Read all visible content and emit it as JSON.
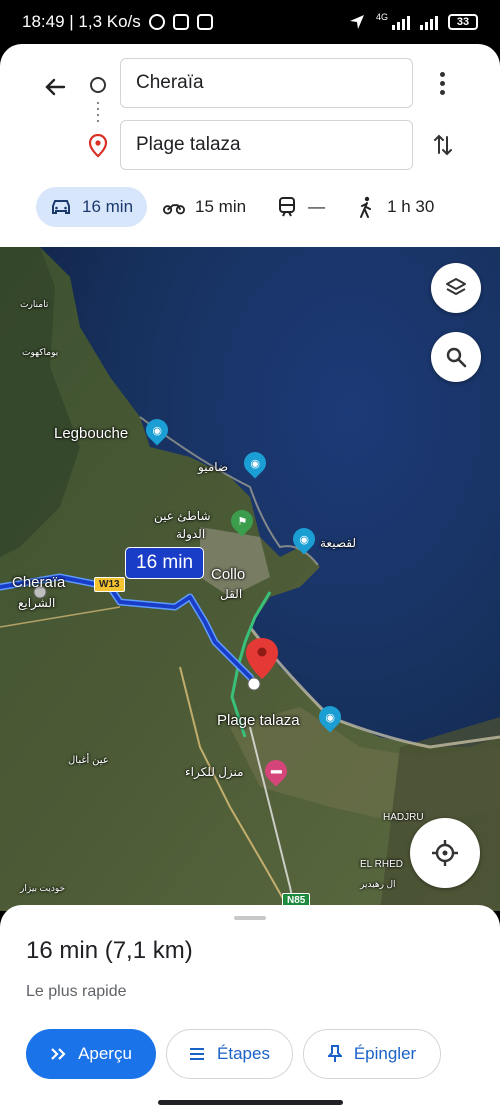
{
  "status_bar": {
    "time_speed": "18:49 | 1,3 Ko/s",
    "network_tag": "4G",
    "battery": "33"
  },
  "directions": {
    "origin": "Cheraïa",
    "destination": "Plage talaza"
  },
  "modes": [
    {
      "name": "car",
      "label": "16 min",
      "active": true
    },
    {
      "name": "motorbike",
      "label": "15 min",
      "active": false
    },
    {
      "name": "transit",
      "label": "—",
      "active": false
    },
    {
      "name": "walk",
      "label": "1 h 30",
      "active": false
    }
  ],
  "map": {
    "route_badge": "16 min",
    "road_w13": "W13",
    "road_n85": "N85",
    "labels": {
      "cheraia": "Cheraïa",
      "cheraia_ar": "الشرايع",
      "legbouche": "Legbouche",
      "dhamiou": "ضاميو",
      "chatt_ain": "شاطئ عين",
      "dawla": "الدولة",
      "collo": "Collo",
      "collo_ar": "القل",
      "qasia": "لقصيعة",
      "plage_talaza": "Plage talaza",
      "manzil": "منزل للكراء",
      "ain_aghbal": "عين أغبال",
      "boumakhout": "بوماكهوت",
      "tamnajat": "تامنارت",
      "hadjr": "HADJRU",
      "el_rhed": "EL RHED",
      "rhedir": "ال رهيدير",
      "khoudiyet": "خوديت بيزار"
    }
  },
  "sheet": {
    "summary": "16 min (7,1 km)",
    "subtitle": "Le plus rapide",
    "buttons": {
      "overview": "Aperçu",
      "steps": "Étapes",
      "pin": "Épingler"
    }
  },
  "colors": {
    "route": "#1a3dc8",
    "accent": "#1a73e8",
    "active_mode_bg": "#d8e6fb"
  }
}
